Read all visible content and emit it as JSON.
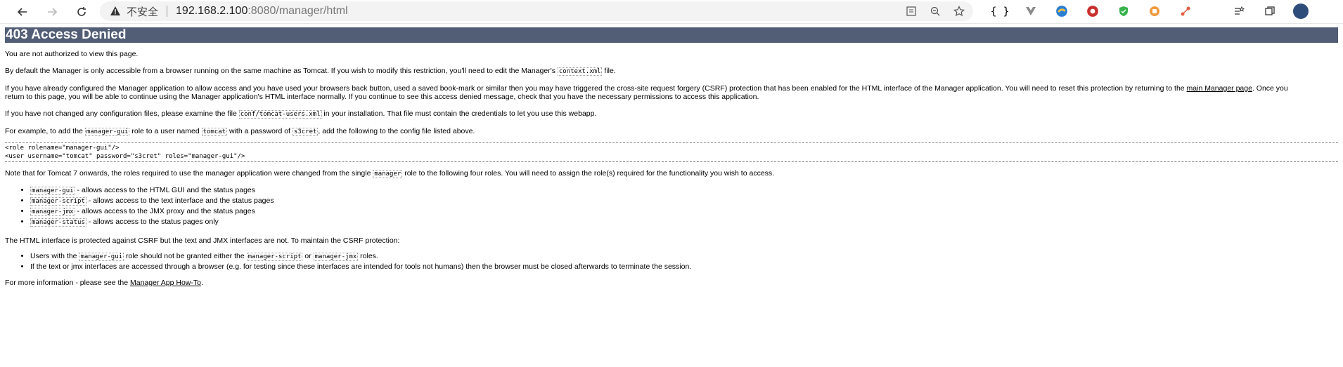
{
  "browser": {
    "insecure_label": "不安全",
    "url_host": "192.168.2.100",
    "url_path": ":8080/manager/html"
  },
  "extensions": {
    "json_label": "{ }"
  },
  "page": {
    "title": "403 Access Denied",
    "p1": "You are not authorized to view this page.",
    "p2_a": "By default the Manager is only accessible from a browser running on the same machine as Tomcat. If you wish to modify this restriction, you'll need to edit the Manager's ",
    "p2_code": "context.xml",
    "p2_b": " file.",
    "p3_a": "If you have already configured the Manager application to allow access and you have used your browsers back button, used a saved book-mark or similar then you may have triggered the cross-site request forgery (CSRF) protection that has been enabled for the HTML interface of the Manager application. You will need to reset this protection by returning to the ",
    "p3_link": "main Manager page",
    "p3_b": ". Once you",
    "p3_c": "return to this page, you will be able to continue using the Manager application's HTML interface normally. If you continue to see this access denied message, check that you have the necessary permissions to access this application.",
    "p4_a": "If you have not changed any configuration files, please examine the file ",
    "p4_code": "conf/tomcat-users.xml",
    "p4_b": " in your installation. That file must contain the credentials to let you use this webapp.",
    "p5_a": "For example, to add the ",
    "p5_code1": "manager-gui",
    "p5_b": " role to a user named ",
    "p5_code2": "tomcat",
    "p5_c": " with a password of ",
    "p5_code3": "s3cret",
    "p5_d": ", add the following to the config file listed above.",
    "pre_line1": "<role rolename=\"manager-gui\"/>",
    "pre_line2": "<user username=\"tomcat\" password=\"s3cret\" roles=\"manager-gui\"/>",
    "p6_a": "Note that for Tomcat 7 onwards, the roles required to use the manager application were changed from the single ",
    "p6_code": "manager",
    "p6_b": " role to the following four roles. You will need to assign the role(s) required for the functionality you wish to access.",
    "roles": [
      {
        "code": "manager-gui",
        "desc": " - allows access to the HTML GUI and the status pages"
      },
      {
        "code": "manager-script",
        "desc": " - allows access to the text interface and the status pages"
      },
      {
        "code": "manager-jmx",
        "desc": " - allows access to the JMX proxy and the status pages"
      },
      {
        "code": "manager-status",
        "desc": " - allows access to the status pages only"
      }
    ],
    "p7": "The HTML interface is protected against CSRF but the text and JMX interfaces are not. To maintain the CSRF protection:",
    "csrf_1_a": "Users with the ",
    "csrf_1_code1": "manager-gui",
    "csrf_1_b": " role should not be granted either the ",
    "csrf_1_code2": "manager-script",
    "csrf_1_c": " or ",
    "csrf_1_code3": "manager-jmx",
    "csrf_1_d": " roles.",
    "csrf_2": "If the text or jmx interfaces are accessed through a browser (e.g. for testing since these interfaces are intended for tools not humans) then the browser must be closed afterwards to terminate the session.",
    "p8_a": "For more information - please see the ",
    "p8_link": "Manager App How-To",
    "p8_b": "."
  }
}
